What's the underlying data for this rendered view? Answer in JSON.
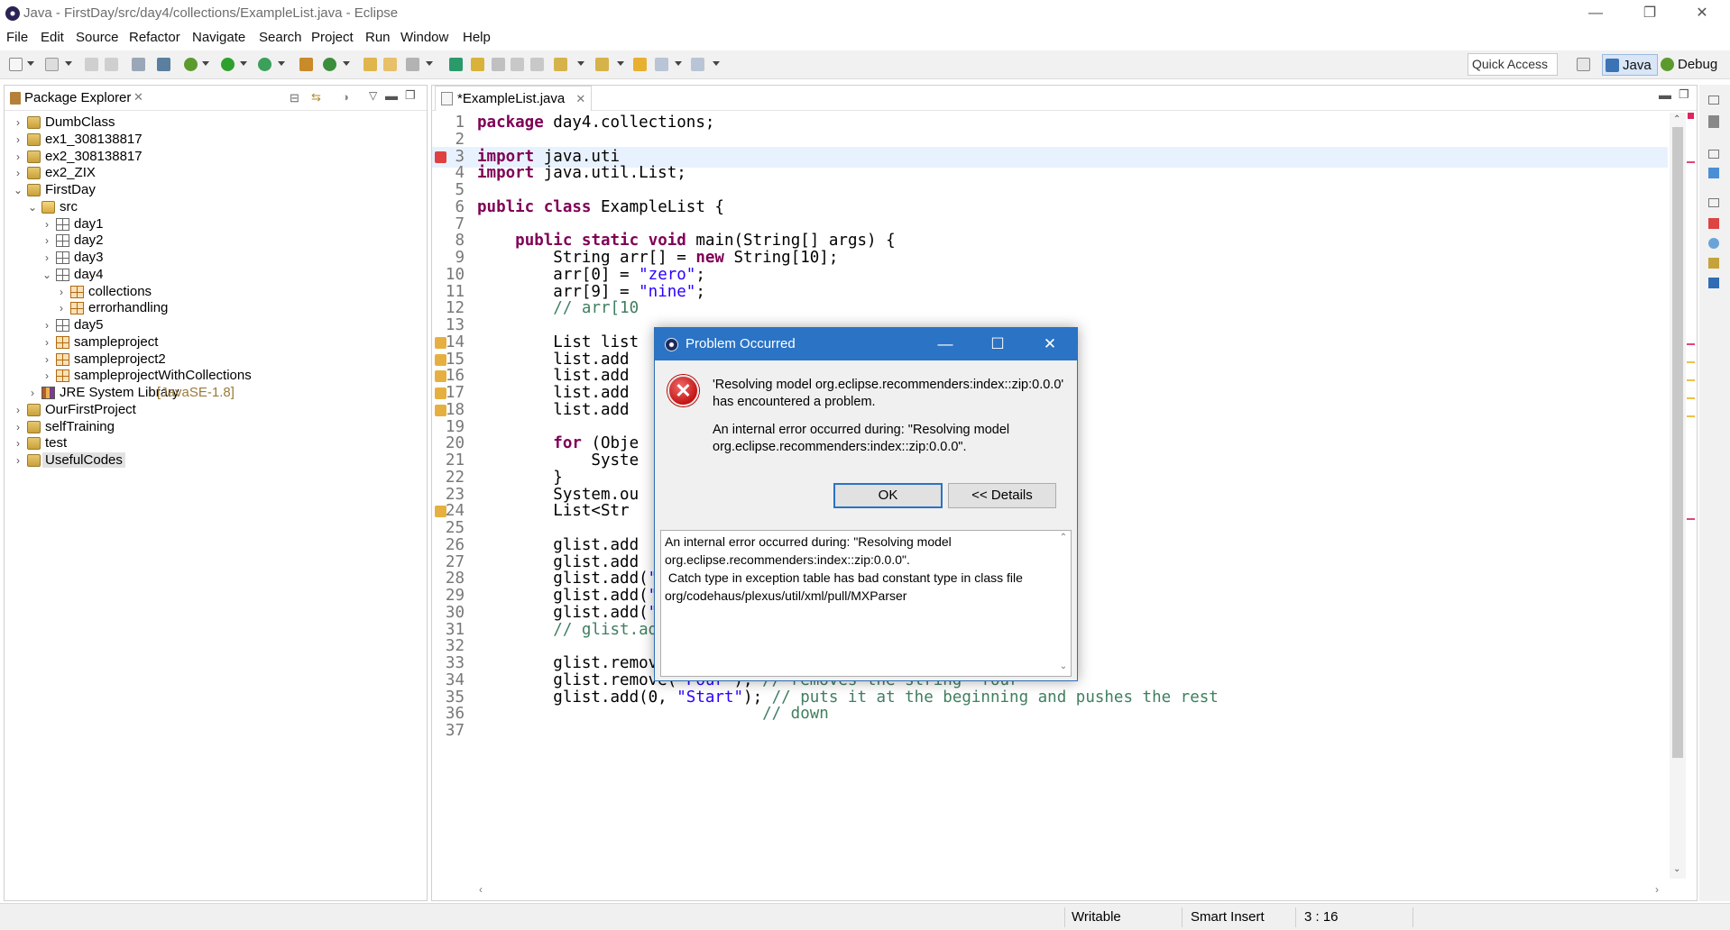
{
  "window": {
    "title": "Java - FirstDay/src/day4/collections/ExampleList.java - Eclipse",
    "controls": {
      "minimize": "—",
      "restore": "❐",
      "close": "✕"
    }
  },
  "menu": [
    "File",
    "Edit",
    "Source",
    "Refactor",
    "Navigate",
    "Search",
    "Project",
    "Run",
    "Window",
    "Help"
  ],
  "toolbar": {
    "quick_access": "Quick Access",
    "perspectives": [
      {
        "label": "Java",
        "active": true
      },
      {
        "label": "Debug",
        "active": false
      }
    ]
  },
  "package_explorer": {
    "tab_label": "Package Explorer",
    "tree": [
      {
        "label": "DumbClass",
        "depth": 0,
        "expanded": false,
        "icon": "project-icon"
      },
      {
        "label": "ex1_308138817",
        "depth": 0,
        "expanded": false,
        "icon": "project-icon"
      },
      {
        "label": "ex2_308138817",
        "depth": 0,
        "expanded": false,
        "icon": "project-icon"
      },
      {
        "label": "ex2_ZIX",
        "depth": 0,
        "expanded": false,
        "icon": "project-icon"
      },
      {
        "label": "FirstDay",
        "depth": 0,
        "expanded": true,
        "icon": "project-icon"
      },
      {
        "label": "src",
        "depth": 1,
        "expanded": true,
        "icon": "source-folder-icon"
      },
      {
        "label": "day1",
        "depth": 2,
        "expanded": false,
        "icon": "package-icon"
      },
      {
        "label": "day2",
        "depth": 2,
        "expanded": false,
        "icon": "package-icon"
      },
      {
        "label": "day3",
        "depth": 2,
        "expanded": false,
        "icon": "package-icon"
      },
      {
        "label": "day4",
        "depth": 2,
        "expanded": true,
        "icon": "package-icon"
      },
      {
        "label": "collections",
        "depth": 3,
        "expanded": false,
        "icon": "package-warning-icon"
      },
      {
        "label": "errorhandling",
        "depth": 3,
        "expanded": false,
        "icon": "package-warning-icon"
      },
      {
        "label": "day5",
        "depth": 2,
        "expanded": false,
        "icon": "package-icon"
      },
      {
        "label": "sampleproject",
        "depth": 2,
        "expanded": false,
        "icon": "package-warning-icon"
      },
      {
        "label": "sampleproject2",
        "depth": 2,
        "expanded": false,
        "icon": "package-warning-icon"
      },
      {
        "label": "sampleprojectWithCollections",
        "depth": 2,
        "expanded": false,
        "icon": "package-warning-icon"
      },
      {
        "label": "JRE System Library",
        "suffix": "[JavaSE-1.8]",
        "depth": 1,
        "expanded": false,
        "icon": "library-icon"
      },
      {
        "label": "OurFirstProject",
        "depth": 0,
        "expanded": false,
        "icon": "project-icon"
      },
      {
        "label": "selfTraining",
        "depth": 0,
        "expanded": false,
        "icon": "project-icon"
      },
      {
        "label": "test",
        "depth": 0,
        "expanded": false,
        "icon": "project-icon"
      },
      {
        "label": "UsefulCodes",
        "depth": 0,
        "expanded": false,
        "icon": "project-icon",
        "selected": true
      }
    ]
  },
  "editor": {
    "tab_label": "*ExampleList.java",
    "lines": [
      {
        "n": "1",
        "code": "package day4.collections;"
      },
      {
        "n": "2",
        "code": ""
      },
      {
        "n": "3",
        "code": "import java.uti",
        "marker": "error",
        "highlight": true
      },
      {
        "n": "4",
        "code": "import java.util.List;"
      },
      {
        "n": "5",
        "code": ""
      },
      {
        "n": "6",
        "code": "public class ExampleList {"
      },
      {
        "n": "7",
        "code": ""
      },
      {
        "n": "8",
        "code": "    public static void main(String[] args) {"
      },
      {
        "n": "9",
        "code": "        String arr[] = new String[10];"
      },
      {
        "n": "10",
        "code": "        arr[0] = \"zero\";"
      },
      {
        "n": "11",
        "code": "        arr[9] = \"nine\";"
      },
      {
        "n": "12",
        "code": "        // arr[10"
      },
      {
        "n": "13",
        "code": ""
      },
      {
        "n": "14",
        "code": "        List list",
        "marker": "warning"
      },
      {
        "n": "15",
        "code": "        list.add",
        "marker": "warning"
      },
      {
        "n": "16",
        "code": "        list.add",
        "marker": "warning"
      },
      {
        "n": "17",
        "code": "        list.add",
        "marker": "warning"
      },
      {
        "n": "18",
        "code": "        list.add",
        "marker": "warning"
      },
      {
        "n": "19",
        "code": ""
      },
      {
        "n": "20",
        "code": "        for (Obje"
      },
      {
        "n": "21",
        "code": "            Syste"
      },
      {
        "n": "22",
        "code": "        }"
      },
      {
        "n": "23",
        "code": "        System.ou"
      },
      {
        "n": "24",
        "code": "        List<Str",
        "marker": "warning"
      },
      {
        "n": "25",
        "code": ""
      },
      {
        "n": "26",
        "code": "        glist.add"
      },
      {
        "n": "27",
        "code": "        glist.add"
      },
      {
        "n": "28",
        "code": "        glist.add(\"Two\");"
      },
      {
        "n": "29",
        "code": "        glist.add(\"Three\");"
      },
      {
        "n": "30",
        "code": "        glist.add(\"Four\");"
      },
      {
        "n": "31",
        "code": "        // glist.add(5); //cannot add a number"
      },
      {
        "n": "32",
        "code": ""
      },
      {
        "n": "33",
        "code": "        glist.remove(2); // removes third place (glist[2])"
      },
      {
        "n": "34",
        "code": "        glist.remove(\"Four\"); // removes the string \"four\""
      },
      {
        "n": "35",
        "code": "        glist.add(0, \"Start\"); // puts it at the beginning and pushes the rest"
      },
      {
        "n": "36",
        "code": "                              // down"
      },
      {
        "n": "37",
        "code": ""
      }
    ]
  },
  "status_bar": {
    "mode": "Writable",
    "insert": "Smart Insert",
    "position": "3 : 16"
  },
  "dialog": {
    "title": "Problem Occurred",
    "message_line1": "'Resolving model org.eclipse.recommenders:index::zip:0.0.0'",
    "message_line2": "has encountered a problem.",
    "detail_line1": "An internal error occurred during: \"Resolving model",
    "detail_line2": "org.eclipse.recommenders:index::zip:0.0.0\".",
    "ok_label": "OK",
    "details_label": "<< Details",
    "details_text": "An internal error occurred during: \"Resolving model\norg.eclipse.recommenders:index::zip:0.0.0\".\n Catch type in exception table has bad constant type in class file\norg/codehaus/plexus/util/xml/pull/MXParser"
  },
  "colors": {
    "keyword": "#7f0055",
    "string": "#2a00ff",
    "comment": "#3f7f5f",
    "dialog_title": "#2b73c5"
  }
}
